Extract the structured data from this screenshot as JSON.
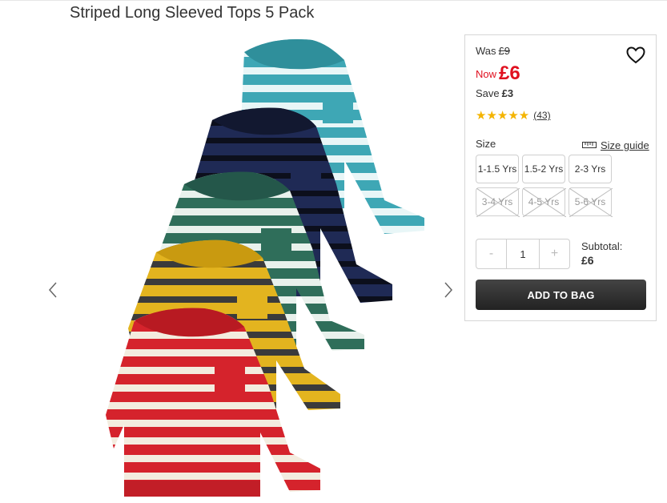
{
  "product": {
    "title": "Striped Long Sleeved Tops 5 Pack"
  },
  "pricing": {
    "was_label": "Was",
    "was_price": "£9",
    "now_label": "Now",
    "now_price": "£6",
    "save_label": "Save",
    "save_amount": "£3"
  },
  "rating": {
    "stars": "★★★★★",
    "review_count": "(43)"
  },
  "size": {
    "label": "Size",
    "guide_label": "Size guide",
    "options": [
      {
        "label": "1-1.5 Yrs",
        "available": true
      },
      {
        "label": "1.5-2 Yrs",
        "available": true
      },
      {
        "label": "2-3 Yrs",
        "available": true
      },
      {
        "label": "3-4 Yrs",
        "available": false
      },
      {
        "label": "4-5 Yrs",
        "available": false
      },
      {
        "label": "5-6 Yrs",
        "available": false
      }
    ]
  },
  "quantity": {
    "minus": "-",
    "value": "1",
    "plus": "+"
  },
  "subtotal": {
    "label": "Subtotal:",
    "value": "£6"
  },
  "cart": {
    "add_label": "ADD TO BAG"
  },
  "colors": {
    "sale_red": "#e0101f",
    "star_gold": "#f4b400",
    "button_dark": "#2b2b2b"
  },
  "icons": {
    "wishlist": "heart-icon",
    "size_guide": "ruler-icon",
    "prev": "chevron-left-icon",
    "next": "chevron-right-icon"
  }
}
